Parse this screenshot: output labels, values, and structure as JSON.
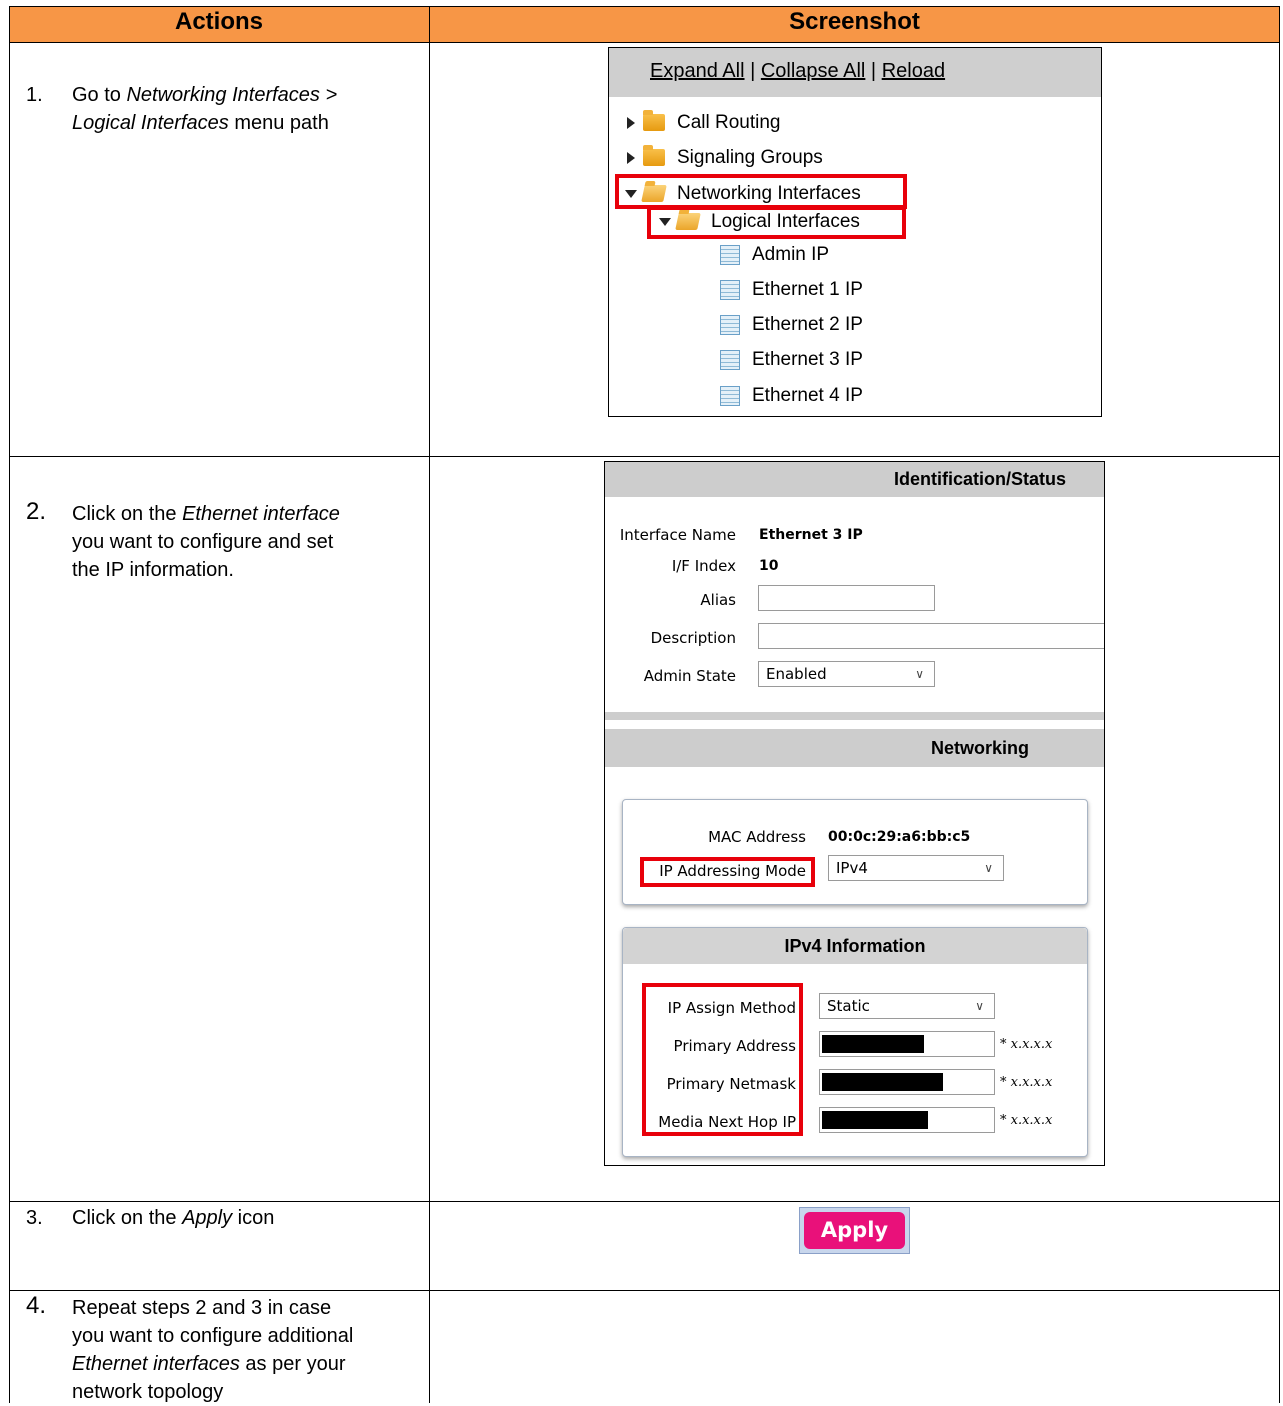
{
  "header": {
    "actions": "Actions",
    "screenshot": "Screenshot"
  },
  "steps": [
    {
      "num": "1.",
      "pre": "Go to ",
      "italic1": "Networking Interfaces >",
      "italic2": "Logical Interfaces",
      "post": " menu path"
    },
    {
      "num": "2.",
      "pre": "Click on the ",
      "italic": "Ethernet interface",
      "line2": "you want to configure and set",
      "line3": "the IP information."
    },
    {
      "num": "3.",
      "pre": "Click on the ",
      "italic": "Apply",
      "post": " icon"
    },
    {
      "num": "4.",
      "line1": "Repeat steps 2 and 3 in case",
      "line2": "you want to configure additional",
      "italic": "Ethernet interfaces",
      "line3post": " as per your",
      "line4": "network topology"
    }
  ],
  "tree": {
    "expand_all": "Expand All",
    "sep": "|",
    "collapse_all": "Collapse All",
    "reload": "Reload",
    "items": [
      {
        "label": "Call Routing",
        "icon": "folder-icon"
      },
      {
        "label": "Signaling Groups",
        "icon": "folder-icon"
      },
      {
        "label": "Networking Interfaces",
        "icon": "folder-open-icon"
      },
      {
        "label": "Logical Interfaces",
        "icon": "folder-open-icon"
      },
      {
        "label": "Admin IP",
        "icon": "table-icon"
      },
      {
        "label": "Ethernet 1 IP",
        "icon": "table-icon"
      },
      {
        "label": "Ethernet 2 IP",
        "icon": "table-icon"
      },
      {
        "label": "Ethernet 3 IP",
        "icon": "table-icon"
      },
      {
        "label": "Ethernet 4 IP",
        "icon": "table-icon"
      }
    ]
  },
  "form": {
    "identification_title": "Identification/Status",
    "interface_name_label": "Interface Name",
    "interface_name_value": "Ethernet 3 IP",
    "if_index_label": "I/F Index",
    "if_index_value": "10",
    "alias_label": "Alias",
    "alias_value": "",
    "description_label": "Description",
    "description_value": "",
    "admin_state_label": "Admin State",
    "admin_state_value": "Enabled",
    "networking_title": "Networking",
    "mac_label": "MAC Address",
    "mac_value": "00:0c:29:a6:bb:c5",
    "ip_mode_label": "IP Addressing Mode",
    "ip_mode_value": "IPv4",
    "ipv4_title": "IPv4 Information",
    "assign_label": "IP Assign Method",
    "assign_value": "Static",
    "primary_address_label": "Primary Address",
    "primary_netmask_label": "Primary Netmask",
    "next_hop_label": "Media Next Hop IP",
    "hint": "* x.x.x.x"
  },
  "apply_label": "Apply",
  "colors": {
    "header": "#f79646",
    "highlight": "#e8000a",
    "apply": "#e9117a"
  }
}
